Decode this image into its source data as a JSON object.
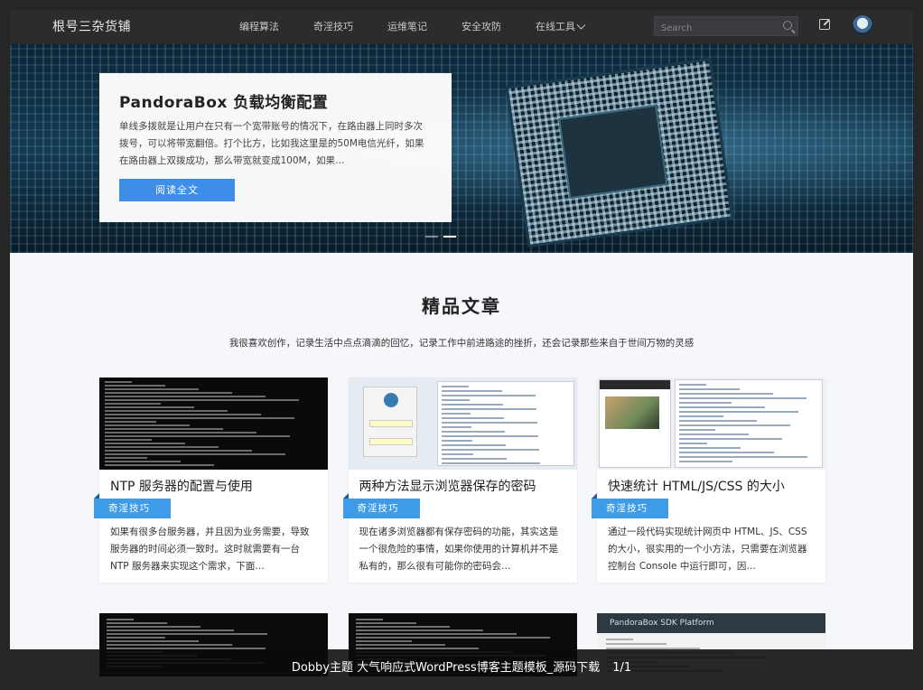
{
  "site": {
    "logo": "根号三杂货铺",
    "nav": [
      "编程算法",
      "奇淫技巧",
      "运维笔记",
      "安全攻防",
      "在线工具"
    ],
    "search_placeholder": "Search"
  },
  "hero": {
    "title": "PandoraBox 负载均衡配置",
    "excerpt": "单线多拨就是让用户在只有一个宽带账号的情况下，在路由器上同时多次拨号，可以将带宽翻倍。打个比方，比如我这里是的50M电信光纤，如果在路由器上双拨成功，那么带宽就变成100M，如果…",
    "button": "阅读全文",
    "slides_total": 2,
    "slide_active": 2
  },
  "section": {
    "title": "精品文章",
    "subtitle": "我很喜欢创作，记录生活中点点滴滴的回忆，记录工作中前进路途的挫折，还会记录那些来自于世间万物的灵感"
  },
  "cards": [
    {
      "title": "NTP 服务器的配置与使用",
      "tag": "奇淫技巧",
      "excerpt": "如果有很多台服务器，并且因为业务需要，导致服务器的时间必须一致时。这时就需要有一台 NTP 服务器来实现这个需求，下面…"
    },
    {
      "title": "两种方法显示浏览器保存的密码",
      "tag": "奇淫技巧",
      "excerpt": "现在诸多浏览器都有保存密码的功能，其实这是一个很危险的事情，如果你使用的计算机并不是私有的，那么很有可能你的密码会…"
    },
    {
      "title": "快速统计 HTML/JS/CSS 的大小",
      "tag": "奇淫技巧",
      "excerpt": "通过一段代码实现统计网页中 HTML、JS、CSS 的大小，很实用的一个小方法，只需要在浏览器控制台 Console 中运行即可，因…"
    }
  ],
  "row2_labels": {
    "sdk": "PandoraBox SDK Platform"
  },
  "caption": {
    "text": "Dobby主题 大气响应式WordPress博客主题模板_源码下载",
    "counter": "1/1"
  },
  "colors": {
    "accent": "#3e8ee8",
    "header": "#2b2c2e",
    "tag": "#3e9be8"
  }
}
